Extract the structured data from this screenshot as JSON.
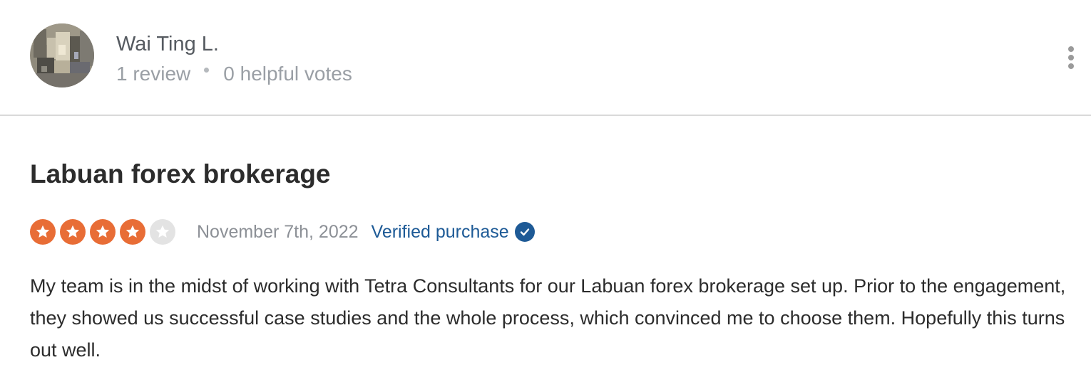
{
  "reviewer": {
    "name": "Wai Ting L.",
    "reviews": "1 review",
    "helpful_votes": "0 helpful votes"
  },
  "review": {
    "title": "Labuan forex brokerage",
    "rating": 4,
    "rating_max": 5,
    "date": "November 7th, 2022",
    "verified_label": "Verified purchase",
    "body": "My team is in the midst of working with Tetra Consultants for our Labuan forex brokerage set up. Prior to the engagement, they showed us successful case studies and the whole process, which convinced me to choose them. Hopefully this turns out well."
  },
  "colors": {
    "star_filled": "#e86d36",
    "star_empty": "#e3e3e3",
    "verified_blue": "#1e5a96"
  },
  "icons": {
    "menu": "more-vertical-icon",
    "star": "star-icon",
    "verified": "check-circle-icon"
  }
}
